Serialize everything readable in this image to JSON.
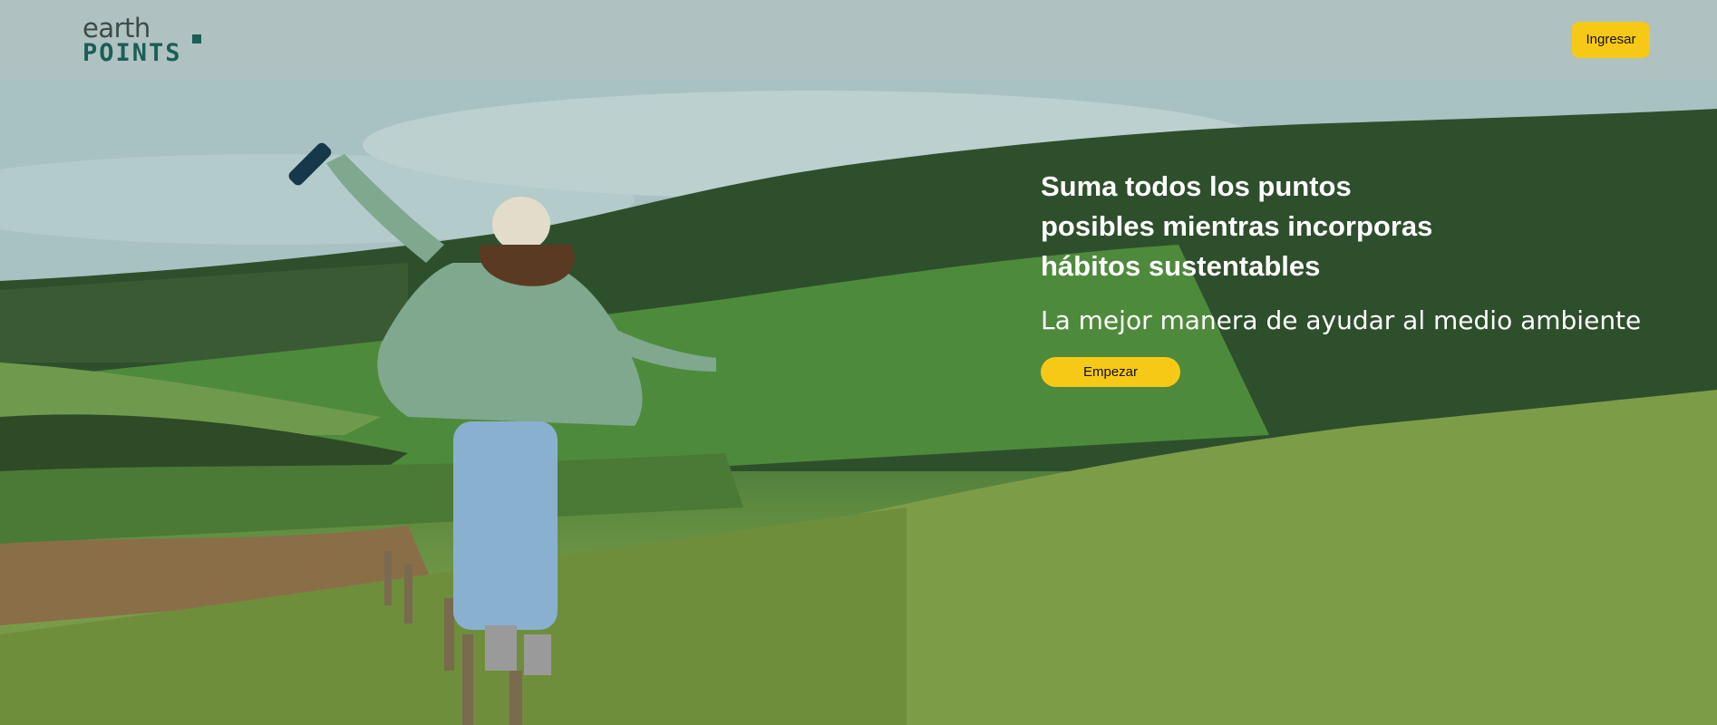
{
  "header": {
    "logo_top": "earth",
    "logo_bottom": "POINTS",
    "login_label": "Ingresar"
  },
  "hero": {
    "headline_lines": [
      "Suma todos los puntos",
      "posibles mientras incorporas",
      "hábitos sustentables"
    ],
    "subtitle": "La mejor manera de ayudar al medio ambiente",
    "cta_label": "Empezar"
  },
  "colors": {
    "accent": "#f7c917",
    "logo_dark": "#1b5e57",
    "logo_text": "#3d4a4a"
  }
}
